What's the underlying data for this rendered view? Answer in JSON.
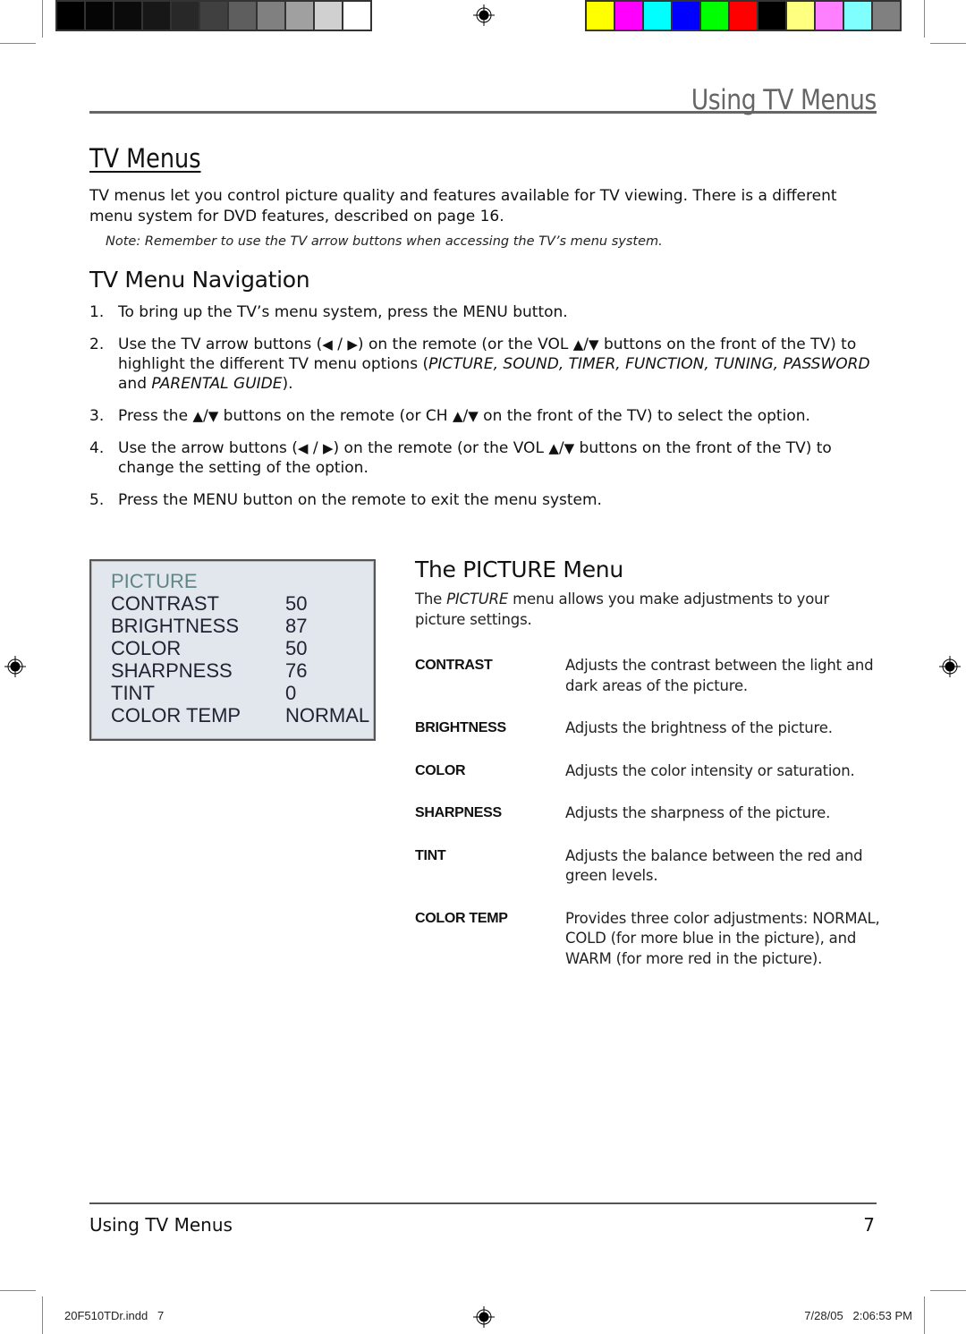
{
  "header": {
    "title": "Using TV Menus"
  },
  "section_tv_menus": {
    "heading": "TV Menus",
    "intro": "TV menus let you control picture quality and features available for TV viewing. There is a different menu system for DVD features, described on page 16.",
    "note": "Note: Remember to use the TV arrow buttons when accessing the TV’s menu system."
  },
  "navigation": {
    "heading": "TV Menu Navigation",
    "steps": [
      {
        "num": "1.",
        "html": "To bring up the TV’s menu system, press the MENU button."
      },
      {
        "num": "2.",
        "html": "Use the TV arrow buttons (<span class=\"tri\">◀</span> / <span class=\"tri\">▶</span>) on the remote (or the VOL <span class=\"tri\">▲</span>/<span class=\"tri\">▼</span> buttons on the front of the TV) to highlight the different TV menu options (<i>PICTURE, SOUND, TIMER, FUNCTION, TUNING, PASSWORD</i> and <i>PARENTAL GUIDE</i>)."
      },
      {
        "num": "3.",
        "html": "Press the <span class=\"tri\">▲</span>/<span class=\"tri\">▼</span> buttons on the remote (or CH <span class=\"tri\">▲</span>/<span class=\"tri\">▼</span> on the front of the TV) to select the option."
      },
      {
        "num": "4.",
        "html": "Use the arrow buttons (<span class=\"tri\">◀</span> / <span class=\"tri\">▶</span>) on the remote (or the VOL <span class=\"tri\">▲</span>/<span class=\"tri\">▼</span> buttons on the front of the TV) to change the setting of the option."
      },
      {
        "num": "5.",
        "html": "Press the MENU button on the remote to exit the menu system."
      }
    ]
  },
  "osd_menu": {
    "title": "PICTURE",
    "rows": [
      {
        "label": "CONTRAST",
        "value": "50"
      },
      {
        "label": "BRIGHTNESS",
        "value": "87"
      },
      {
        "label": "COLOR",
        "value": "50"
      },
      {
        "label": "SHARPNESS",
        "value": "76"
      },
      {
        "label": "TINT",
        "value": "0"
      },
      {
        "label": "COLOR TEMP",
        "value": "NORMAL"
      }
    ]
  },
  "picture_menu": {
    "heading": "The PICTURE Menu",
    "intro_html": "The <i>PICTURE</i> menu allows you make adjustments to your picture settings.",
    "definitions": [
      {
        "term": "CONTRAST",
        "desc": "Adjusts the contrast between the light and dark areas of the picture."
      },
      {
        "term": "BRIGHTNESS",
        "desc": "Adjusts the brightness of the picture."
      },
      {
        "term": "COLOR",
        "desc": "Adjusts the color intensity or saturation."
      },
      {
        "term": "SHARPNESS",
        "desc": "Adjusts the sharpness of the picture."
      },
      {
        "term": "TINT",
        "desc": "Adjusts the balance between the red and green levels."
      },
      {
        "term": "COLOR TEMP",
        "desc": "Provides three color adjustments: NORMAL, COLD (for more blue in the picture), and WARM (for more red in the picture)."
      }
    ]
  },
  "footer": {
    "title": "Using TV Menus",
    "page": "7"
  },
  "slug": {
    "file": "20F510TDr.indd   7",
    "datetime": "7/28/05   2:06:53 PM"
  },
  "print_marks": {
    "gray_bar_colors": [
      "#000000",
      "#050505",
      "#0b0b0b",
      "#171717",
      "#282828",
      "#404040",
      "#5e5e5e",
      "#808080",
      "#a0a0a0",
      "#d0d0d0",
      "#ffffff"
    ],
    "color_bar_colors": [
      "#ffff00",
      "#ff00ff",
      "#00ffff",
      "#0000ff",
      "#00ff00",
      "#ff0000",
      "#000000",
      "#ffff80",
      "#ff80ff",
      "#80ffff",
      "#808080"
    ]
  }
}
